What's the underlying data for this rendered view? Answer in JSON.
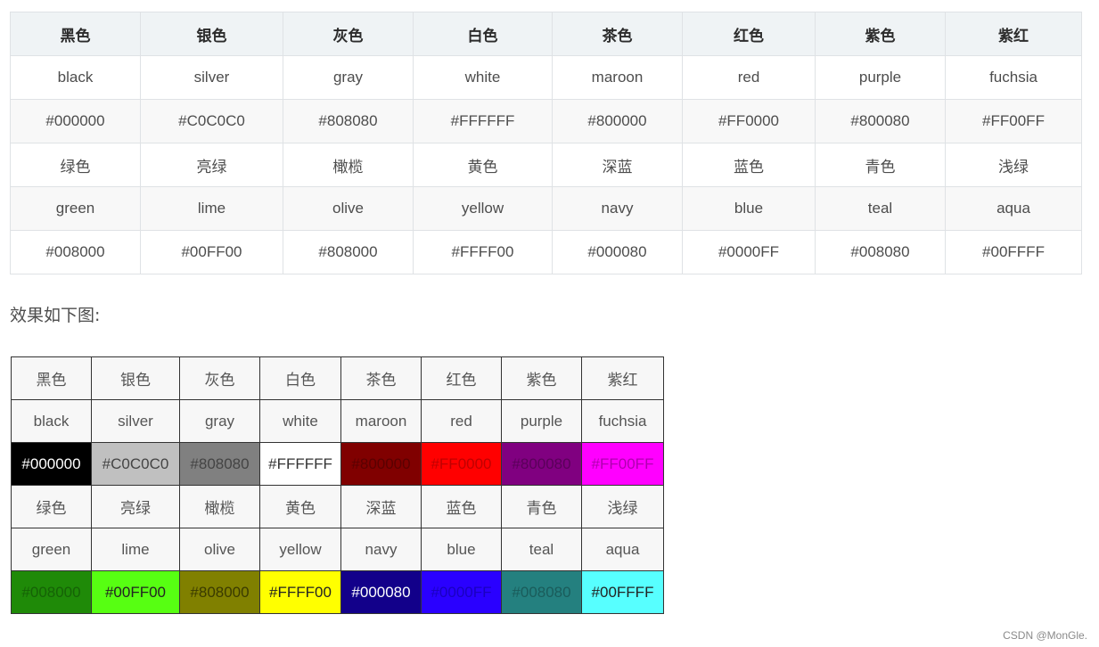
{
  "color_table": {
    "headers": [
      "黑色",
      "银色",
      "灰色",
      "白色",
      "茶色",
      "红色",
      "紫色",
      "紫红"
    ],
    "rows": [
      [
        "black",
        "silver",
        "gray",
        "white",
        "maroon",
        "red",
        "purple",
        "fuchsia"
      ],
      [
        "#000000",
        "#C0C0C0",
        "#808080",
        "#FFFFFF",
        "#800000",
        "#FF0000",
        "#800080",
        "#FF00FF"
      ],
      [
        "绿色",
        "亮绿",
        "橄榄",
        "黄色",
        "深蓝",
        "蓝色",
        "青色",
        "浅绿"
      ],
      [
        "green",
        "lime",
        "olive",
        "yellow",
        "navy",
        "blue",
        "teal",
        "aqua"
      ],
      [
        "#008000",
        "#00FF00",
        "#808000",
        "#FFFF00",
        "#000080",
        "#0000FF",
        "#008080",
        "#00FFFF"
      ]
    ]
  },
  "paragraph": "效果如下图:",
  "result_table": {
    "rows": [
      [
        "黑色",
        "银色",
        "灰色",
        "白色",
        "茶色",
        "红色",
        "紫色",
        "紫红"
      ],
      [
        "black",
        "silver",
        "gray",
        "white",
        "maroon",
        "red",
        "purple",
        "fuchsia"
      ],
      [
        "#000000",
        "#C0C0C0",
        "#808080",
        "#FFFFFF",
        "#800000",
        "#FF0000",
        "#800080",
        "#FF00FF"
      ],
      [
        "绿色",
        "亮绿",
        "橄榄",
        "黄色",
        "深蓝",
        "蓝色",
        "青色",
        "浅绿"
      ],
      [
        "green",
        "lime",
        "olive",
        "yellow",
        "navy",
        "blue",
        "teal",
        "aqua"
      ],
      [
        "#008000",
        "#00FF00",
        "#808000",
        "#FFFF00",
        "#000080",
        "#0000FF",
        "#008080",
        "#00FFFF"
      ]
    ],
    "swatch_rows": [
      2,
      5
    ],
    "swatch_colors": [
      [
        "#000000",
        "#c0c0c0",
        "#808080",
        "#ffffff",
        "#800000",
        "#ff0000",
        "#800080",
        "#ff00ff"
      ],
      [
        "#1f8a08",
        "#57ff12",
        "#808000",
        "#ffff00",
        "#12008a",
        "#2a00ff",
        "#24807f",
        "#57ffff"
      ]
    ],
    "swatch_text_colors": [
      [
        "#ffffff",
        "#444444",
        "#444444",
        "#333333",
        "#5a0000",
        "#c00000",
        "#5a005a",
        "#b000b0"
      ],
      [
        "#156206",
        "#222222",
        "#3a3a00",
        "#222222",
        "#ffffff",
        "#1a00c0",
        "#1a5c5b",
        "#222222"
      ]
    ]
  },
  "watermark": "CSDN @MonGle."
}
